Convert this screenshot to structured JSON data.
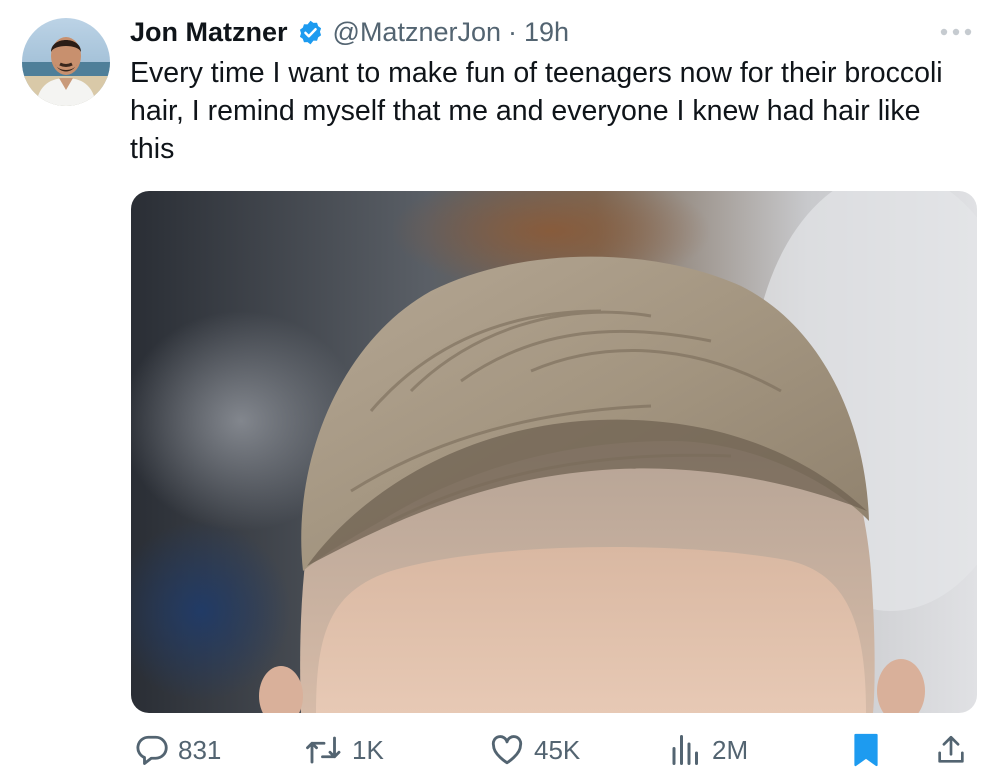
{
  "author": {
    "name": "Jon Matzner",
    "handle": "@MatznerJon",
    "separator": "·",
    "time": "19h",
    "verified": true,
    "avatar_icon": "profile-photo"
  },
  "tweet": {
    "text": "Every time I want to make fun of teenagers now for their broccoli hair, I remind myself that me and everyone I knew had hair like this",
    "media_icon": "haircut-photo"
  },
  "actions": {
    "replies": "831",
    "retweets": "1K",
    "likes": "45K",
    "views": "2M",
    "bookmarked": true
  },
  "colors": {
    "verified": "#1d9bf0",
    "bookmark": "#1d9bf0",
    "secondary_text": "#536471",
    "primary_text": "#0f1419"
  }
}
